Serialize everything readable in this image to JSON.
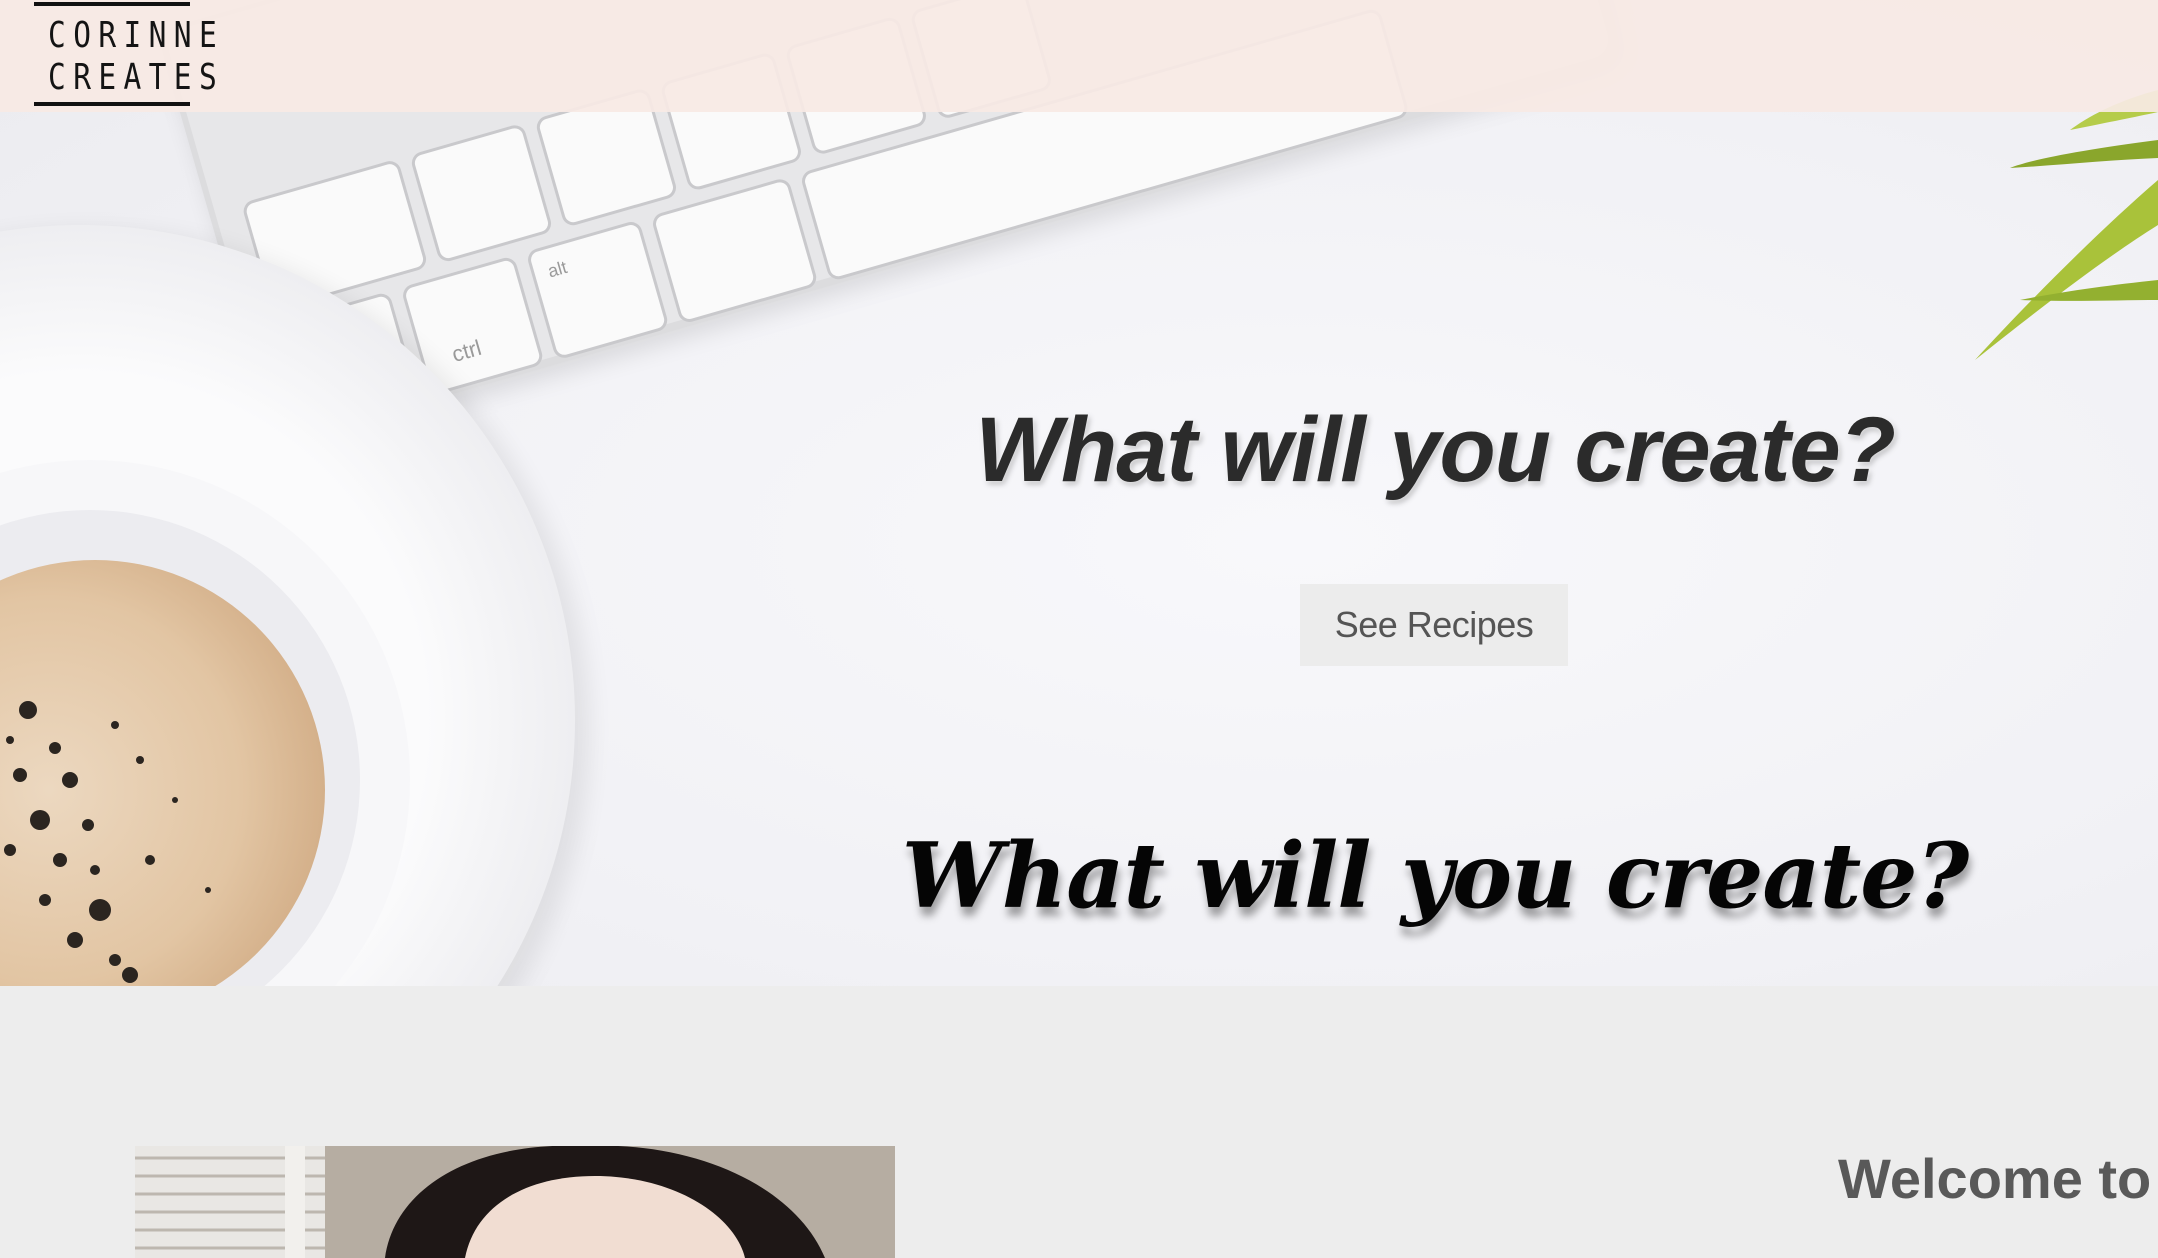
{
  "header": {
    "logo_line_1": "CORINNE",
    "logo_line_2": "CREATES"
  },
  "hero": {
    "title": "What will you create?",
    "button_label": "See Recipes",
    "title_serif": "What will you create?"
  },
  "about": {
    "heading": "Welcome to r"
  },
  "colors": {
    "header_bg": "#f7eae4",
    "hero_bg": "#f4f4f7",
    "section_bg": "#ededed",
    "button_bg": "#ececec",
    "button_text": "#555555",
    "heading_text": "#595959"
  },
  "images": {
    "hero_background": "desk-keyboard-coffee-plant",
    "about_photo": "woman-portrait-photo"
  }
}
